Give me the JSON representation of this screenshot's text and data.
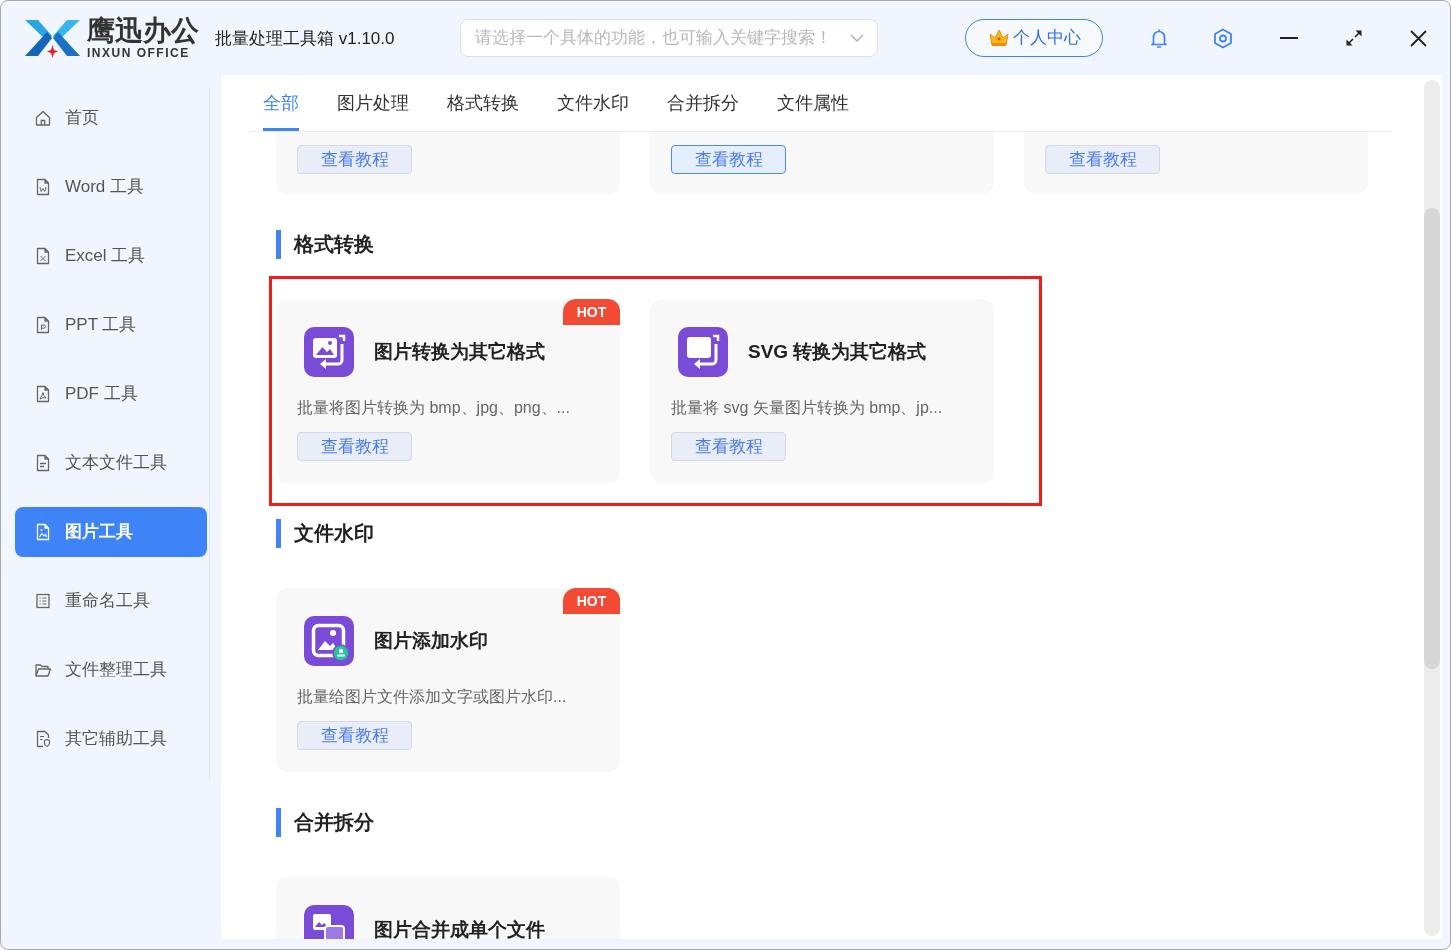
{
  "window": {
    "brand": "鹰迅办公",
    "brand_subtitle": "INXUN OFFICE",
    "title": "批量处理工具箱 v1.10.0"
  },
  "search": {
    "placeholder": "请选择一个具体的功能，也可输入关键字搜索！"
  },
  "account_button": {
    "label": "个人中心"
  },
  "sidebar": {
    "items": [
      {
        "label": "首页",
        "selected": false
      },
      {
        "label": "Word 工具",
        "selected": false
      },
      {
        "label": "Excel 工具",
        "selected": false
      },
      {
        "label": "PPT 工具",
        "selected": false
      },
      {
        "label": "PDF 工具",
        "selected": false
      },
      {
        "label": "文本文件工具",
        "selected": false
      },
      {
        "label": "图片工具",
        "selected": true
      },
      {
        "label": "重命名工具",
        "selected": false
      },
      {
        "label": "文件整理工具",
        "selected": false
      },
      {
        "label": "其它辅助工具",
        "selected": false
      }
    ]
  },
  "tabs": [
    {
      "label": "全部",
      "selected": true
    },
    {
      "label": "图片处理",
      "selected": false
    },
    {
      "label": "格式转换",
      "selected": false
    },
    {
      "label": "文件水印",
      "selected": false
    },
    {
      "label": "合并拆分",
      "selected": false
    },
    {
      "label": "文件属性",
      "selected": false
    }
  ],
  "sections": [
    {
      "outlined": false,
      "cards": [
        {
          "button": "查看教程",
          "hovered": false
        },
        {
          "button": "查看教程",
          "hovered": true
        },
        {
          "button": "查看教程",
          "hovered": false
        }
      ]
    },
    {
      "title": "格式转换",
      "outlined": true,
      "cards": [
        {
          "title": "图片转换为其它格式",
          "description": "批量将图片转换为 bmp、jpg、png、...",
          "badge": "HOT",
          "button": "查看教程",
          "hovered": false
        },
        {
          "title": "SVG 转换为其它格式",
          "description": "批量将 svg 矢量图片转换为 bmp、jp...",
          "button": "查看教程",
          "hovered": false
        }
      ]
    },
    {
      "title": "文件水印",
      "outlined": false,
      "cards": [
        {
          "title": "图片添加水印",
          "description": "批量给图片文件添加文字或图片水印...",
          "badge": "HOT",
          "button": "查看教程",
          "hovered": false
        }
      ]
    },
    {
      "title": "合并拆分",
      "outlined": false,
      "cards": [
        {
          "title": "图片合并成单个文件"
        }
      ]
    }
  ]
}
